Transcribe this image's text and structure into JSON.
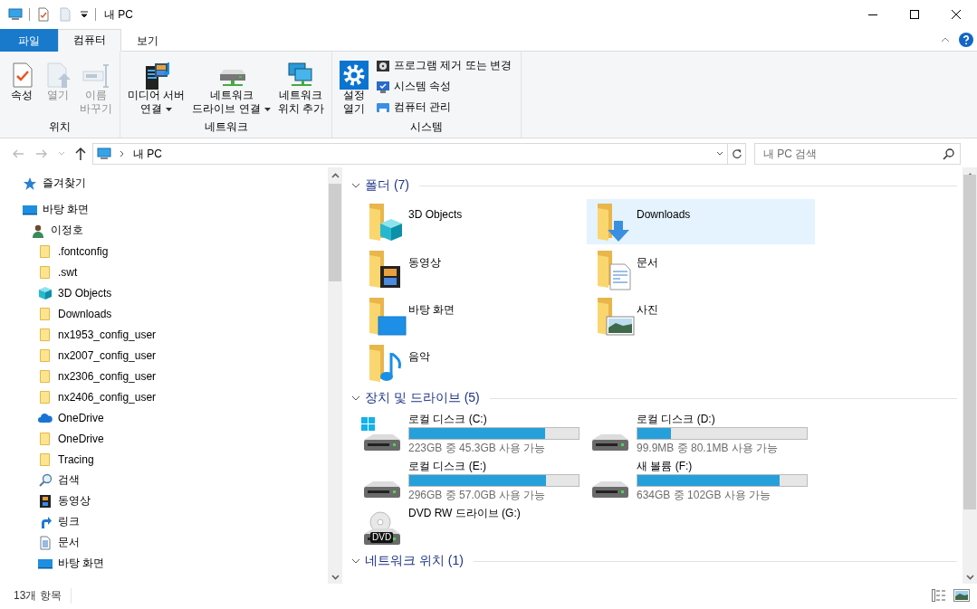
{
  "window": {
    "title": "내 PC"
  },
  "ribbon": {
    "tabs": [
      {
        "label": "파일",
        "kind": "file",
        "selected": false
      },
      {
        "label": "컴퓨터",
        "kind": "tab",
        "selected": true
      },
      {
        "label": "보기",
        "kind": "tab",
        "selected": false
      }
    ],
    "groups": [
      {
        "label": "위치",
        "buttons": [
          {
            "lines": [
              "속성"
            ],
            "kind": "properties",
            "disabled": false,
            "dropdown": false
          },
          {
            "lines": [
              "열기"
            ],
            "kind": "open",
            "disabled": true,
            "dropdown": false
          },
          {
            "lines": [
              "이름",
              "바꾸기"
            ],
            "kind": "rename",
            "disabled": true,
            "dropdown": false
          }
        ]
      },
      {
        "label": "네트워크",
        "buttons": [
          {
            "lines": [
              "미디어 서버",
              "연결"
            ],
            "kind": "media",
            "disabled": false,
            "dropdown": true
          },
          {
            "lines": [
              "네트워크",
              "드라이브 연결"
            ],
            "kind": "drive",
            "disabled": false,
            "dropdown": true
          },
          {
            "lines": [
              "네트워크",
              "위치 추가"
            ],
            "kind": "location",
            "disabled": false,
            "dropdown": false
          }
        ]
      },
      {
        "label": "시스템",
        "buttons": [
          {
            "lines": [
              "설정",
              "열기"
            ],
            "kind": "settings",
            "disabled": false,
            "dropdown": false
          }
        ],
        "commands": [
          {
            "label": "프로그램 제거 또는 변경",
            "kind": "programs",
            "disabled": false
          },
          {
            "label": "시스템 속성",
            "kind": "system",
            "disabled": false
          },
          {
            "label": "컴퓨터 관리",
            "kind": "manage",
            "disabled": false
          }
        ]
      }
    ]
  },
  "address_bar": {
    "path": [
      "내 PC"
    ]
  },
  "search": {
    "placeholder": "내 PC 검색"
  },
  "navigation_pane": {
    "items": [
      {
        "label": "즐겨찾기",
        "kind": "star"
      },
      {
        "label": "바탕 화면",
        "kind": "desktop",
        "children": [
          {
            "label": "이정호",
            "kind": "user",
            "children": [
              {
                "label": ".fontconfig",
                "kind": "folder"
              },
              {
                "label": ".swt",
                "kind": "folder"
              },
              {
                "label": "3D Objects",
                "kind": "cube"
              },
              {
                "label": "Downloads",
                "kind": "folder"
              },
              {
                "label": "nx1953_config_user",
                "kind": "folder"
              },
              {
                "label": "nx2007_config_user",
                "kind": "folder"
              },
              {
                "label": "nx2306_config_user",
                "kind": "folder"
              },
              {
                "label": "nx2406_config_user",
                "kind": "folder"
              },
              {
                "label": "OneDrive",
                "kind": "cloud"
              },
              {
                "label": "OneDrive",
                "kind": "folder"
              },
              {
                "label": "Tracing",
                "kind": "folder"
              },
              {
                "label": "검색",
                "kind": "search"
              },
              {
                "label": "동영상",
                "kind": "film"
              },
              {
                "label": "링크",
                "kind": "link"
              },
              {
                "label": "문서",
                "kind": "document"
              },
              {
                "label": "바탕 화면",
                "kind": "desktop"
              }
            ]
          }
        ]
      }
    ]
  },
  "content": {
    "sections": [
      {
        "title": "폴더 (7)",
        "expanded": true,
        "kind": "folders",
        "items": [
          {
            "label": "3D Objects",
            "kind": "cube",
            "selected": false
          },
          {
            "label": "Downloads",
            "kind": "download",
            "selected": true
          },
          {
            "label": "동영상",
            "kind": "film",
            "selected": false
          },
          {
            "label": "문서",
            "kind": "document",
            "selected": false
          },
          {
            "label": "바탕 화면",
            "kind": "desktop",
            "selected": false
          },
          {
            "label": "사진",
            "kind": "picture",
            "selected": false
          },
          {
            "label": "음악",
            "kind": "music",
            "selected": false
          }
        ]
      },
      {
        "title": "장치 및 드라이브 (5)",
        "expanded": true,
        "kind": "drives",
        "items": [
          {
            "label": "로컬 디스크 (C:)",
            "kind": "system",
            "level": 0.8,
            "detail": "223GB 중 45.3GB 사용 가능"
          },
          {
            "label": "로컬 디스크 (D:)",
            "kind": "disk",
            "level": 0.2,
            "detail": "99.9MB 중 80.1MB 사용 가능"
          },
          {
            "label": "로컬 디스크 (E:)",
            "kind": "disk",
            "level": 0.81,
            "detail": "296GB 중 57.0GB 사용 가능"
          },
          {
            "label": "새 볼륨 (F:)",
            "kind": "disk",
            "level": 0.84,
            "detail": "634GB 중 102GB 사용 가능"
          },
          {
            "label": "DVD RW 드라이브 (G:)",
            "kind": "dvd",
            "badge": "DVD"
          }
        ]
      },
      {
        "title": "네트워크 위치 (1)",
        "expanded": true,
        "kind": "network"
      }
    ]
  },
  "status_bar": {
    "text": "13개 항목"
  }
}
